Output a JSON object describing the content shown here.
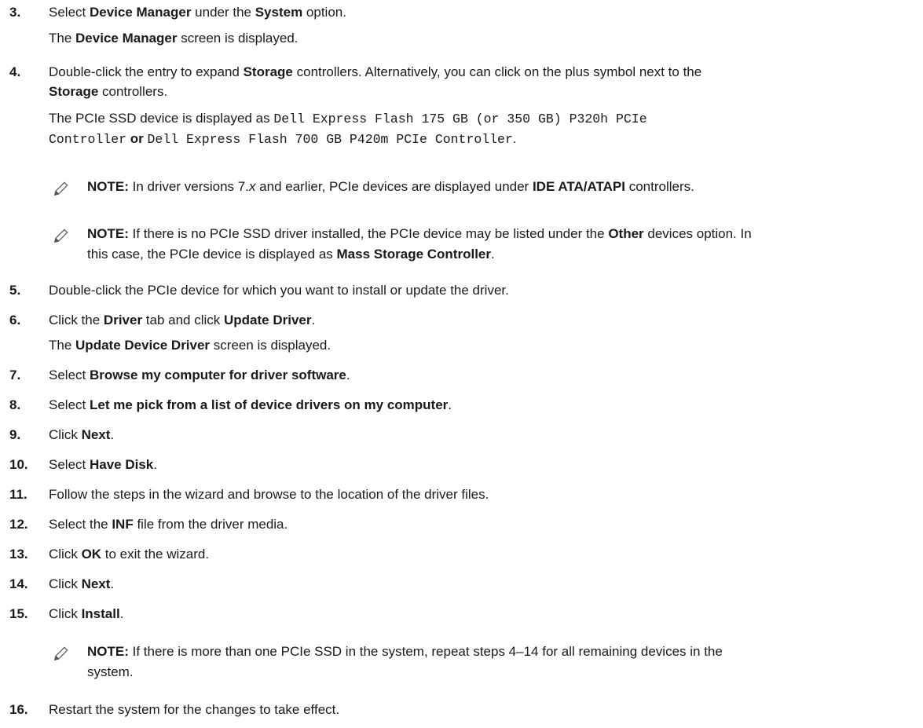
{
  "steps": {
    "s3": {
      "num": "3.",
      "a": "Select ",
      "b1": "Device Manager",
      "c": " under the ",
      "b2": "System",
      "d": " option.",
      "r1": "The ",
      "r2": "Device Manager",
      "r3": " screen is displayed."
    },
    "s4": {
      "num": "4.",
      "l1a": "Double-click the entry to expand ",
      "l1b": "Storage",
      "l1c": " controllers. Alternatively, you can click on the plus symbol next to the",
      "l2b": "Storage",
      "l2c": " controllers.",
      "r1a": "The PCIe SSD device is displayed as ",
      "r1m": "Dell Express Flash 175 GB (or 350 GB) P320h PCIe",
      "r2m": "Controller",
      "r2o": " or ",
      "r2m2": "Dell Express Flash 700 GB P420m PCIe Controller",
      "r2e": "."
    },
    "n1": {
      "label": "NOTE:",
      "a": " In driver versions 7.",
      "x": "x",
      "b": " and earlier, PCIe devices are displayed under ",
      "c": "IDE ATA/ATAPI",
      "d": " controllers."
    },
    "n2": {
      "label": "NOTE:",
      "a": " If there is no PCIe SSD driver installed, the PCIe device may be listed under the ",
      "b": "Other",
      "c": " devices option. In",
      "d": "this case, the PCIe device is displayed as ",
      "e": "Mass Storage Controller",
      "f": "."
    },
    "s5": {
      "num": "5.",
      "t": "Double-click the PCIe device for which you want to install or update the driver."
    },
    "s6": {
      "num": "6.",
      "a": "Click the ",
      "b": "Driver",
      "c": " tab and click ",
      "d": "Update Driver",
      "e": ".",
      "r1": "The ",
      "r2": "Update Device Driver",
      "r3": " screen is displayed."
    },
    "s7": {
      "num": "7.",
      "a": "Select ",
      "b": "Browse my computer for driver software",
      "c": "."
    },
    "s8": {
      "num": "8.",
      "a": "Select ",
      "b": "Let me pick from a list of device drivers on my computer",
      "c": "."
    },
    "s9": {
      "num": "9.",
      "a": "Click ",
      "b": "Next",
      "c": "."
    },
    "s10": {
      "num": "10.",
      "a": "Select ",
      "b": "Have Disk",
      "c": "."
    },
    "s11": {
      "num": "11.",
      "t": "Follow the steps in the wizard and browse to the location of the driver files."
    },
    "s12": {
      "num": "12.",
      "a": "Select the ",
      "b": "INF",
      "c": " file from the driver media."
    },
    "s13": {
      "num": "13.",
      "a": "Click ",
      "b": "OK",
      "c": " to exit the wizard."
    },
    "s14": {
      "num": "14.",
      "a": "Click ",
      "b": "Next",
      "c": "."
    },
    "s15": {
      "num": "15.",
      "a": "Click ",
      "b": "Install",
      "c": "."
    },
    "n3": {
      "label": "NOTE:",
      "a": " If there is more than one PCIe SSD in the system, repeat steps 4–14 for all remaining devices in the",
      "b": "system."
    },
    "s16": {
      "num": "16.",
      "t": "Restart the system for the changes to take effect."
    }
  },
  "icons": {
    "note": "pencil-note-icon"
  },
  "colors": {
    "text": "#1a1a1a",
    "icon": "#555555"
  }
}
